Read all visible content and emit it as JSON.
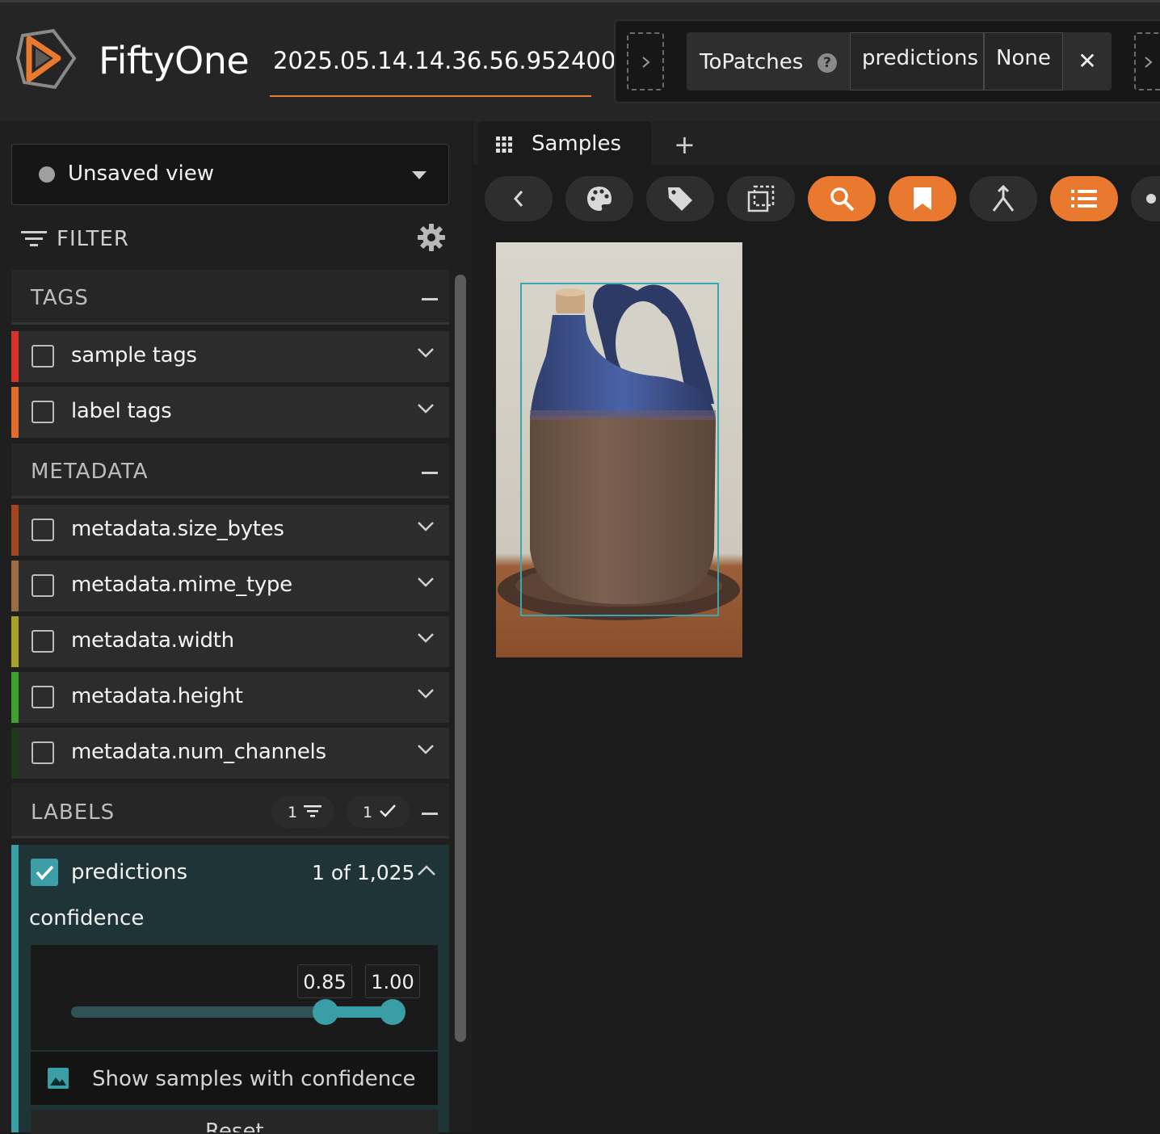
{
  "header": {
    "app_title": "FiftyOne",
    "dataset_name": "2025.05.14.14.36.56.952400",
    "view_stage": {
      "name": "ToPatches",
      "params": [
        "predictions",
        "None"
      ]
    }
  },
  "sidebar": {
    "view_select": "Unsaved view",
    "filter_label": "FILTER",
    "groups": {
      "tags": {
        "title": "TAGS",
        "fields": [
          "sample tags",
          "label tags"
        ]
      },
      "metadata": {
        "title": "METADATA",
        "fields": [
          "metadata.size_bytes",
          "metadata.mime_type",
          "metadata.width",
          "metadata.height",
          "metadata.num_channels"
        ]
      },
      "labels": {
        "title": "LABELS",
        "filter_count": "1",
        "visible_count": "1"
      }
    },
    "predictions": {
      "name": "predictions",
      "count": "1 of 1,025",
      "confidence_label": "confidence",
      "min": "0.85",
      "max": "1.00",
      "range": [
        0.85,
        1.0
      ],
      "show_label": "Show samples with confidence",
      "reset_label": "Reset"
    }
  },
  "main": {
    "tab_label": "Samples",
    "toolbar_icons": [
      "chevron-left-icon",
      "palette-icon",
      "tag-icon",
      "select-icon",
      "search-icon",
      "bookmark-icon",
      "merge-icon",
      "list-icon",
      "more-icon"
    ]
  },
  "colors": {
    "accent": "#e8792f",
    "predictions": "#3a9ea6",
    "stripes": [
      "#d6342a",
      "#e06b2a",
      "#a3461f",
      "#9a6b45",
      "#a9a02c",
      "#3ea12e",
      "#1b3a16"
    ]
  }
}
